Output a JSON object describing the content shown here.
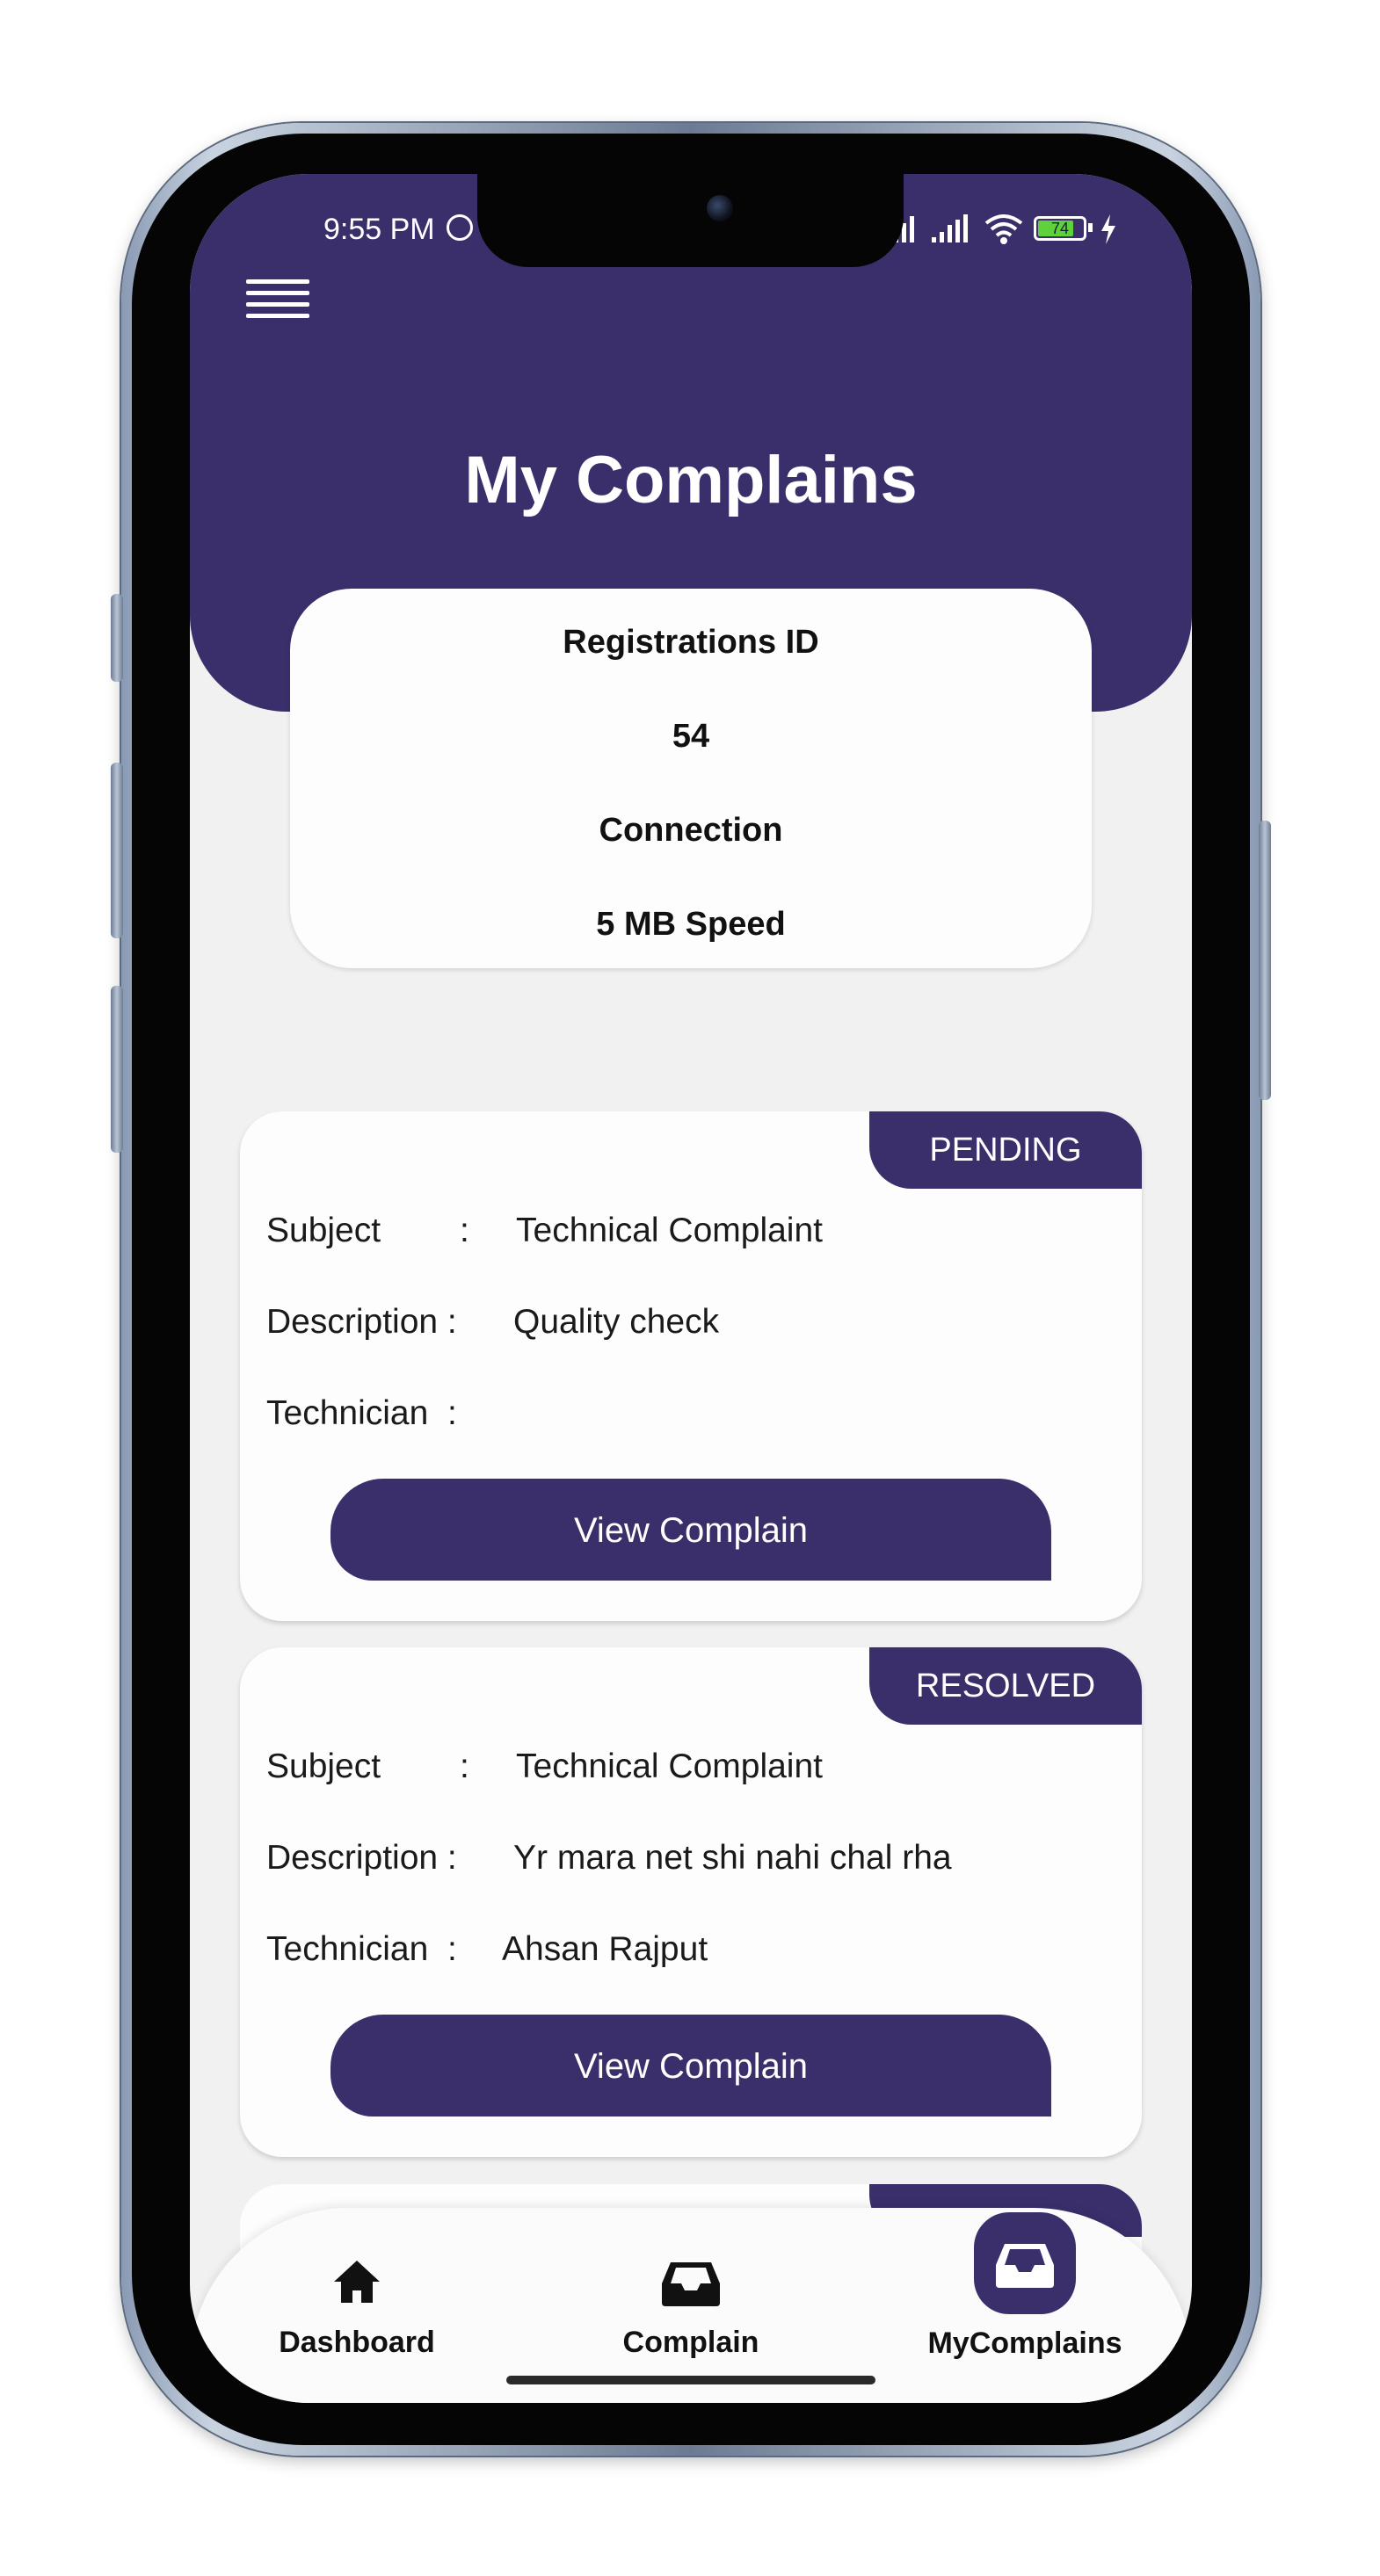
{
  "status_bar": {
    "time": "9:55 PM",
    "battery": "74",
    "signal_text": "ıll .ıll"
  },
  "header": {
    "title": "My Complains",
    "menu_icon": "hamburger-menu-icon"
  },
  "info_card": {
    "registration_label": "Registrations ID",
    "registration_value": "54",
    "connection_label": "Connection",
    "connection_value": "5 MB Speed"
  },
  "complaints": [
    {
      "status": "PENDING",
      "subject_label": "Subject",
      "subject_colon": ":",
      "subject_value": "Technical Complaint",
      "description_label": "Description :",
      "description_value": "Quality check",
      "technician_label": "Technician  :",
      "technician_value": "",
      "button_label": "View Complain"
    },
    {
      "status": "RESOLVED",
      "subject_label": "Subject",
      "subject_colon": ":",
      "subject_value": "Technical Complaint",
      "description_label": "Description :",
      "description_value": "Yr mara net shi nahi chal rha",
      "technician_label": "Technician  :",
      "technician_value": "Ahsan Rajput",
      "button_label": "View Complain"
    }
  ],
  "bottom_nav": {
    "items": [
      {
        "label": "Dashboard",
        "icon": "home-icon",
        "active": false
      },
      {
        "label": "Complain",
        "icon": "inbox-icon",
        "active": false
      },
      {
        "label": "MyComplains",
        "icon": "inbox-icon",
        "active": true
      }
    ]
  },
  "colors": {
    "primary": "#3a2f6b",
    "background": "#f1f1f2",
    "card": "#fdfdfd"
  }
}
